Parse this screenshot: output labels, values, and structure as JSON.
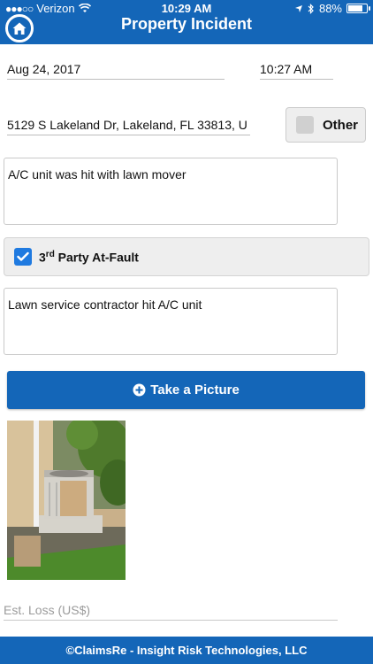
{
  "status_bar": {
    "carrier": "Verizon",
    "time": "10:29 AM",
    "battery": "88%",
    "battery_level": 0.88
  },
  "header": {
    "title": "Property Incident"
  },
  "form": {
    "date": "Aug 24, 2017",
    "time": "10:27 AM",
    "address": "5129 S Lakeland Dr, Lakeland, FL 33813, U",
    "other_label": "Other",
    "other_checked": false,
    "description": "A/C unit was hit with lawn mover",
    "third_party_label_num": "3",
    "third_party_label_sup": "rd",
    "third_party_label_rest": " Party At-Fault",
    "third_party_checked": true,
    "third_party_details": "Lawn service contractor hit A/C unit",
    "take_picture_label": "Take a Picture",
    "est_loss_placeholder": "Est. Loss (US$)"
  },
  "footer": {
    "text": "©ClaimsRe - Insight Risk Technologies, LLC"
  },
  "colors": {
    "brand": "#1466b8",
    "checkbox": "#1f7ae0"
  }
}
